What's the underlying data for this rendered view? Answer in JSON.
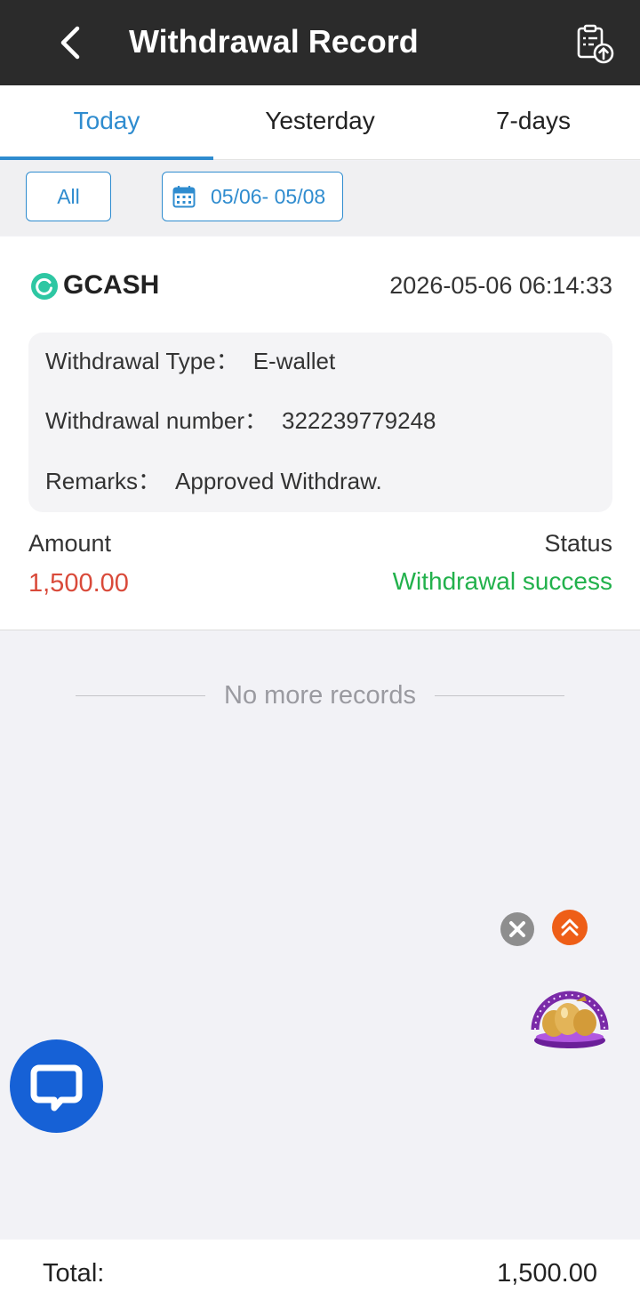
{
  "header": {
    "title": "Withdrawal Record",
    "back_icon": "chevron-left-icon",
    "record_icon": "clipboard-upload-icon",
    "background": "#2b2b2b"
  },
  "tabs": [
    {
      "label": "Today",
      "active": true
    },
    {
      "label": "Yesterday",
      "active": false
    },
    {
      "label": "7-days",
      "active": false
    }
  ],
  "filters": {
    "type_label": "All",
    "date_range": "05/06- 05/08",
    "calendar_icon": "calendar-icon"
  },
  "record": {
    "method": "GCASH",
    "method_icon": "gcash-logo-icon",
    "time": "2026-05-06 06:14:33",
    "type_label": "Withdrawal Type：",
    "type_value": "E-wallet",
    "number_label": "Withdrawal number：",
    "number_value": "322239779248",
    "remarks_label": "Remarks：",
    "remarks_value": "Approved Withdraw.",
    "amount_label": "Amount",
    "amount_value": "1,500.00",
    "status_label": "Status",
    "status_value": "Withdrawal success"
  },
  "list_end_text": "No more records",
  "floating": {
    "close_icon": "close-icon",
    "scroll_top_icon": "double-chevron-up-icon",
    "promo_icon": "golden-eggs-icon",
    "chat_icon": "chat-bubble-icon"
  },
  "footer": {
    "total_label": "Total:",
    "total_value": "1,500.00"
  },
  "colors": {
    "accent": "#2f8ccf",
    "amount": "#d94a3a",
    "success": "#22b14c",
    "chat_button": "#1661d6",
    "scroll_top": "#ee5e17"
  }
}
